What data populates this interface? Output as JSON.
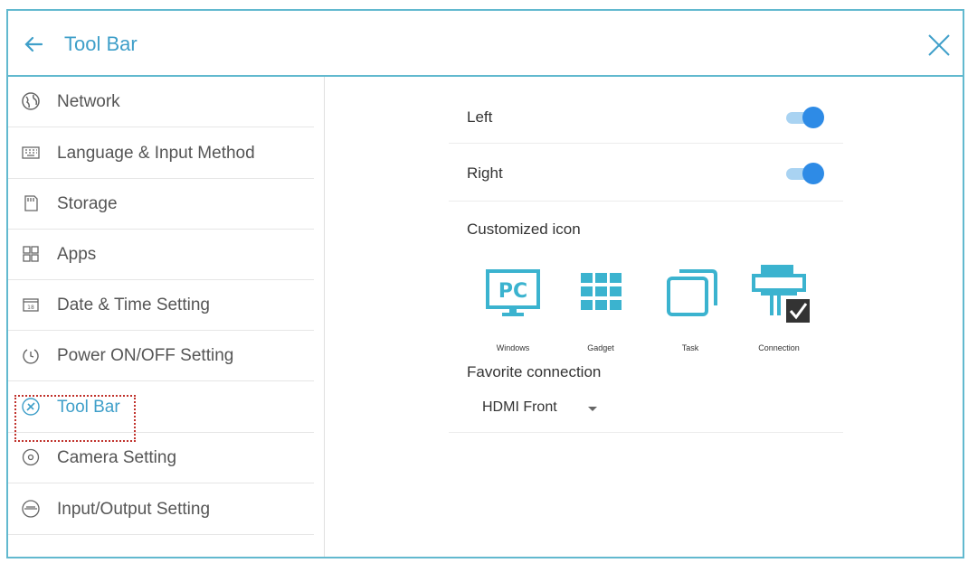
{
  "header": {
    "title": "Tool Bar"
  },
  "sidebar": {
    "items": [
      {
        "label": "Network",
        "icon": "globe-icon"
      },
      {
        "label": "Language & Input Method",
        "icon": "keyboard-icon"
      },
      {
        "label": "Storage",
        "icon": "storage-icon"
      },
      {
        "label": "Apps",
        "icon": "apps-grid-icon"
      },
      {
        "label": "Date & Time Setting",
        "icon": "calendar-icon"
      },
      {
        "label": "Power ON/OFF Setting",
        "icon": "power-icon"
      },
      {
        "label": "Tool Bar",
        "icon": "toolbar-icon",
        "active": true
      },
      {
        "label": "Camera Setting",
        "icon": "camera-icon"
      },
      {
        "label": "Input/Output Setting",
        "icon": "input-output-icon"
      }
    ]
  },
  "main": {
    "left_label": "Left",
    "left_on": true,
    "right_label": "Right",
    "right_on": true,
    "customized_label": "Customized icon",
    "icons": [
      {
        "caption": "Windows",
        "icon": "pc-icon"
      },
      {
        "caption": "Gadget",
        "icon": "gadget-grid-icon"
      },
      {
        "caption": "Task",
        "icon": "task-windows-icon"
      },
      {
        "caption": "Connection",
        "icon": "connection-icon",
        "checked": true
      }
    ],
    "favorite_label": "Favorite connection",
    "favorite_value": "HDMI Front"
  },
  "colors": {
    "accent": "#3f9fc9",
    "toggle_knob": "#2e8be6",
    "toggle_track": "#a9d3f2",
    "icon_teal": "#3bb3cf",
    "highlight": "#c0312b"
  }
}
